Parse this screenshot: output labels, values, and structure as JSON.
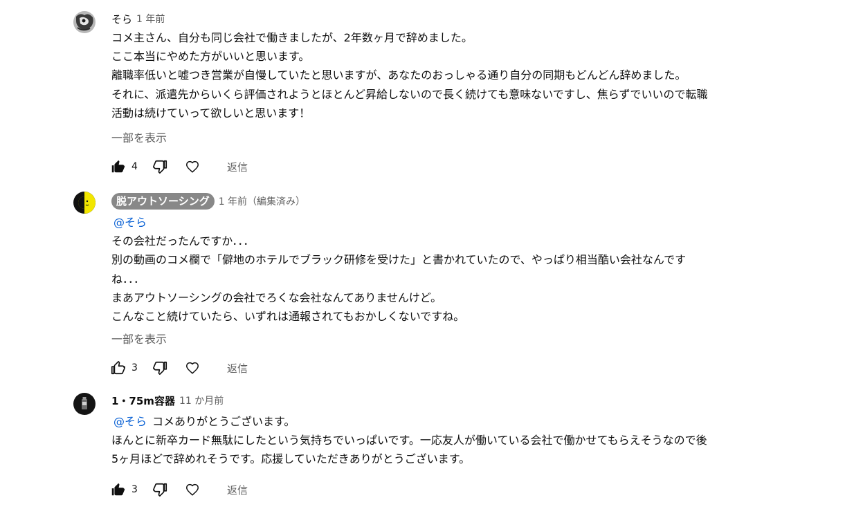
{
  "comments": [
    {
      "author": "そら",
      "time": "1 年前",
      "lines": [
        "コメ主さん、自分も同じ会社で働きましたが、2年数ヶ月で辞めました。",
        "ここ本当にやめた方がいいと思います。",
        "離職率低いと嘘つき営業が自慢していたと思いますが、あなたのおっしゃる通り自分の同期もどんどん辞めました。",
        "それに、派遣先からいくら評価されようとほとんど昇給しないので長く続けても意味ないですし、焦らずでいいので転職",
        "活動は続けていって欲しいと思います！"
      ],
      "show_more": "一部を表示",
      "likes": "4",
      "reply": "返信"
    },
    {
      "author": "脱アウトソーシング",
      "time": "1 年前（編集済み）",
      "mention": "@そら",
      "lines": [
        "その会社だったんですか．．．",
        "別の動画のコメ欄で「僻地のホテルでブラック研修を受けた」と書かれていたので、やっぱり相当酷い会社なんです",
        "ね．．．",
        "まあアウトソーシングの会社でろくな会社なんてありませんけど。",
        "こんなこと続けていたら、いずれは通報されてもおかしくないですね。"
      ],
      "show_more": "一部を表示",
      "likes": "3",
      "reply": "返信"
    },
    {
      "author": "1・75m容器",
      "time": "11 か月前",
      "mention": "@そら",
      "first_line": "コメありがとうございます。",
      "lines": [
        "ほんとに新卒カード無駄にしたという気持ちでいっぱいです。一応友人が働いている会社で働かせてもらえそうなので後",
        "5ヶ月ほどで辞めれそうです。応援していただきありがとうございます。"
      ],
      "likes": "3",
      "reply": "返信"
    }
  ]
}
